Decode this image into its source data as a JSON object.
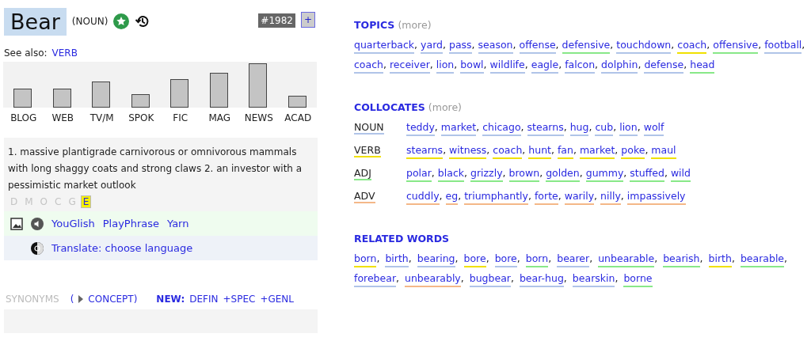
{
  "entry": {
    "word": "Bear",
    "pos": "(NOUN)",
    "rank": "#1982",
    "add": "+"
  },
  "see_also": {
    "label": "See also:",
    "link": "VERB"
  },
  "genres": [
    {
      "label": "BLOG",
      "level": 0.4
    },
    {
      "label": "WEB",
      "level": 0.4
    },
    {
      "label": "TV/M",
      "level": 0.57
    },
    {
      "label": "SPOK",
      "level": 0.27
    },
    {
      "label": "FIC",
      "level": 0.63
    },
    {
      "label": "MAG",
      "level": 0.77
    },
    {
      "label": "NEWS",
      "level": 1.0
    },
    {
      "label": "ACAD",
      "level": 0.25
    }
  ],
  "definition": "1. massive plantigrade carnivorous or omnivorous mammals with long shaggy coats and strong claws 2. an investor with a pessimistic market outlook",
  "letters": [
    {
      "label": "D",
      "selected": false
    },
    {
      "label": "M",
      "selected": false
    },
    {
      "label": "O",
      "selected": false
    },
    {
      "label": "C",
      "selected": false
    },
    {
      "label": "G",
      "selected": false
    },
    {
      "label": "E",
      "selected": true
    }
  ],
  "media_links": [
    "YouGlish",
    "PlayPhrase",
    "Yarn"
  ],
  "translate": "Translate: choose language",
  "synonyms": {
    "label": "SYNONYMS",
    "open": "(",
    "concept": "CONCEPT)",
    "new_label": "NEW:",
    "links": [
      "DEFIN",
      "+SPEC",
      "+GENL"
    ]
  },
  "topics": {
    "title": "TOPICS",
    "more": "(more)",
    "words": [
      {
        "text": "quarterback",
        "sep": ",",
        "color": "#b0c4e8"
      },
      {
        "text": "yard",
        "sep": ",",
        "color": "#b0c4e8"
      },
      {
        "text": "pass",
        "sep": ",",
        "color": "#b0c4e8"
      },
      {
        "text": "season",
        "sep": ",",
        "color": "#b0c4e8"
      },
      {
        "text": "offense",
        "sep": ",",
        "color": "#b0c4e8"
      },
      {
        "text": "defensive",
        "sep": ",",
        "color": "#88e888"
      },
      {
        "text": "touchdown",
        "sep": ",",
        "color": "#b0c4e8"
      },
      {
        "text": "coach",
        "sep": ",",
        "color": "#f0e000"
      },
      {
        "text": "offensive",
        "sep": ",",
        "color": "#88e888"
      },
      {
        "text": "football",
        "sep": ",",
        "color": "#b0c4e8"
      },
      {
        "text": "coach",
        "sep": ",",
        "color": "#b0c4e8"
      },
      {
        "text": "receiver",
        "sep": ",",
        "color": "#b0c4e8"
      },
      {
        "text": "lion",
        "sep": ",",
        "color": "#b0c4e8"
      },
      {
        "text": "bowl",
        "sep": ",",
        "color": "#b0c4e8"
      },
      {
        "text": "wildlife",
        "sep": ",",
        "color": "#b0c4e8"
      },
      {
        "text": "eagle",
        "sep": ",",
        "color": "#b0c4e8"
      },
      {
        "text": "falcon",
        "sep": ",",
        "color": "#b0c4e8"
      },
      {
        "text": "dolphin",
        "sep": ",",
        "color": "#b0c4e8"
      },
      {
        "text": "defense",
        "sep": ",",
        "color": "#b0c4e8"
      },
      {
        "text": "head",
        "color": "#88e888"
      }
    ]
  },
  "collocates": {
    "title": "COLLOCATES",
    "more": "(more)",
    "rows": [
      {
        "pos": "NOUN",
        "color": "#b0c4e8",
        "words": [
          {
            "text": "teddy",
            "sep": ","
          },
          {
            "text": "market",
            "sep": ","
          },
          {
            "text": "chicago",
            "sep": ","
          },
          {
            "text": "stearns",
            "sep": ","
          },
          {
            "text": "hug",
            "sep": ","
          },
          {
            "text": "cub",
            "sep": ","
          },
          {
            "text": "lion",
            "sep": ","
          },
          {
            "text": "wolf"
          }
        ]
      },
      {
        "pos": "VERB",
        "color": "#f0e000",
        "words": [
          {
            "text": "stearns",
            "sep": ","
          },
          {
            "text": "witness",
            "sep": ","
          },
          {
            "text": "coach",
            "sep": ","
          },
          {
            "text": "hunt",
            "sep": ","
          },
          {
            "text": "fan",
            "sep": ","
          },
          {
            "text": "market",
            "sep": ","
          },
          {
            "text": "poke",
            "sep": ","
          },
          {
            "text": "maul"
          }
        ]
      },
      {
        "pos": "ADJ",
        "color": "#88e888",
        "words": [
          {
            "text": "polar",
            "sep": ","
          },
          {
            "text": "black",
            "sep": ","
          },
          {
            "text": "grizzly",
            "sep": ","
          },
          {
            "text": "brown",
            "sep": ","
          },
          {
            "text": "golden",
            "sep": ","
          },
          {
            "text": "gummy",
            "sep": ","
          },
          {
            "text": "stuffed",
            "sep": ","
          },
          {
            "text": "wild"
          }
        ]
      },
      {
        "pos": "ADV",
        "color": "#f4b888",
        "words": [
          {
            "text": "cuddly",
            "sep": ","
          },
          {
            "text": "eg",
            "sep": ","
          },
          {
            "text": "triumphantly",
            "sep": ","
          },
          {
            "text": "forte",
            "sep": ","
          },
          {
            "text": "warily",
            "sep": ","
          },
          {
            "text": "nilly",
            "sep": ","
          },
          {
            "text": "impassively"
          }
        ]
      }
    ]
  },
  "related": {
    "title": "RELATED WORDS",
    "words": [
      {
        "text": "born",
        "sep": ",",
        "color": "#f0e000"
      },
      {
        "text": "birth",
        "sep": ",",
        "color": "#b0c4e8"
      },
      {
        "text": "bearing",
        "sep": ",",
        "color": "#b0c4e8"
      },
      {
        "text": "bore",
        "sep": ",",
        "color": "#f0e000"
      },
      {
        "text": "bore",
        "sep": ",",
        "color": "#b0c4e8"
      },
      {
        "text": "born",
        "sep": ",",
        "color": "#88e888"
      },
      {
        "text": "bearer",
        "sep": ",",
        "color": "#b0c4e8"
      },
      {
        "text": "unbearable",
        "sep": ",",
        "color": "#88e888"
      },
      {
        "text": "bearish",
        "sep": ",",
        "color": "#88e888"
      },
      {
        "text": "birth",
        "sep": ",",
        "color": "#f0e000"
      },
      {
        "text": "bearable",
        "sep": ",",
        "color": "#88e888"
      },
      {
        "text": "forebear",
        "sep": ",",
        "color": "#b0c4e8"
      },
      {
        "text": "unbearably",
        "sep": ",",
        "color": "#f4b888"
      },
      {
        "text": "bugbear",
        "sep": ",",
        "color": "#b0c4e8"
      },
      {
        "text": "bear-hug",
        "sep": ",",
        "color": "#b0c4e8"
      },
      {
        "text": "bearskin",
        "sep": ",",
        "color": "#b0c4e8"
      },
      {
        "text": "borne",
        "color": "#88e888"
      }
    ]
  }
}
